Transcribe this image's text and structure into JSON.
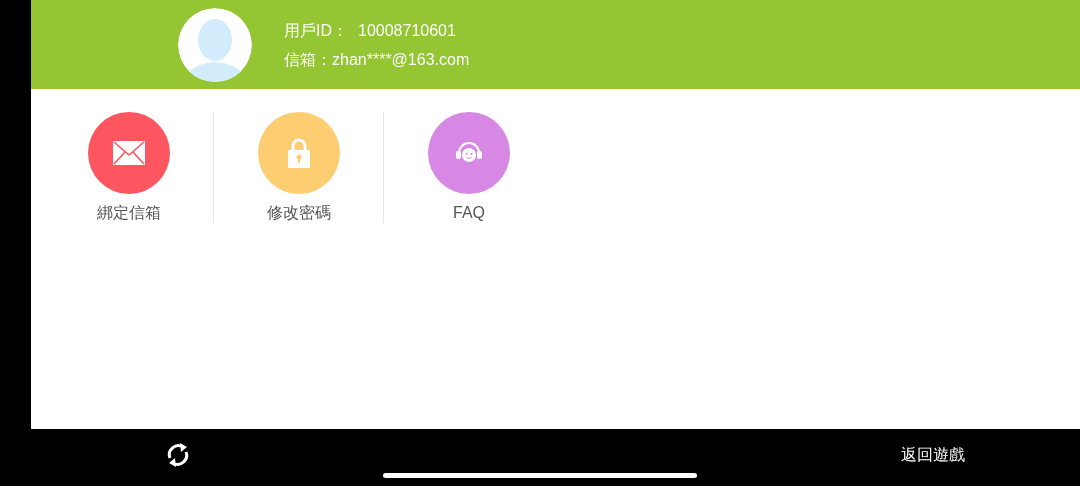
{
  "profile": {
    "user_id_label": "用戶ID：",
    "user_id": "10008710601",
    "email_label": "信箱：",
    "email": "zhan****@163.com"
  },
  "menu": [
    {
      "kind": "mail",
      "label": "綁定信箱",
      "color": "#fe5660"
    },
    {
      "kind": "lock",
      "label": "修改密碼",
      "color": "#fdcd71"
    },
    {
      "kind": "support",
      "label": "FAQ",
      "color": "#d787e4"
    }
  ],
  "footer": {
    "back_label": "返回遊戲"
  }
}
